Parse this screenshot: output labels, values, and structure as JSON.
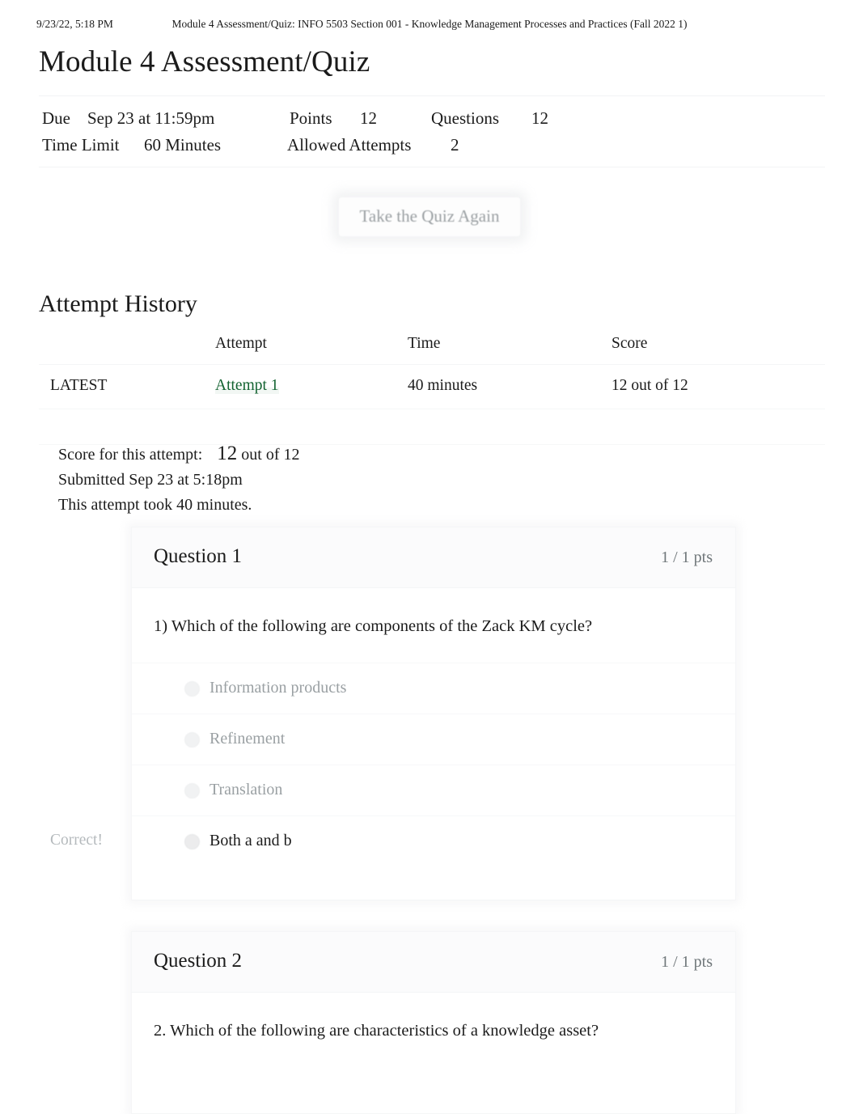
{
  "print_header": {
    "date": "9/23/22, 5:18 PM",
    "doc_title": "Module 4 Assessment/Quiz: INFO 5503 Section 001 - Knowledge Management Processes and Practices (Fall 2022 1)"
  },
  "page_title": "Module 4 Assessment/Quiz",
  "quiz_meta": {
    "due_label": "Due",
    "due_value": "Sep 23 at 11:59pm",
    "points_label": "Points",
    "points_value": "12",
    "questions_label": "Questions",
    "questions_value": "12",
    "time_limit_label": "Time Limit",
    "time_limit_value": "60 Minutes",
    "allowed_attempts_label": "Allowed Attempts",
    "allowed_attempts_value": "2"
  },
  "retake_button": {
    "label": "Take the Quiz Again"
  },
  "attempt_history": {
    "heading": "Attempt History",
    "columns": [
      "",
      "Attempt",
      "Time",
      "Score"
    ],
    "rows": [
      {
        "kept": "LATEST",
        "attempt": "Attempt 1",
        "time": "40 minutes",
        "score": "12 out of 12"
      }
    ]
  },
  "score_summary": {
    "score_label": "Score for this attempt:",
    "score_value": "12",
    "score_outof": "out of 12",
    "submitted": "Submitted Sep 23 at 5:18pm",
    "duration": "This attempt took 40 minutes."
  },
  "questions": [
    {
      "name": "Question 1",
      "points": "1 / 1 pts",
      "text": "1) Which of the following are components of the Zack KM cycle?",
      "correct_tag": "Correct!",
      "answers": [
        {
          "text": "Information products",
          "selected": false
        },
        {
          "text": "Refinement",
          "selected": false
        },
        {
          "text": "Translation",
          "selected": false
        },
        {
          "text": "Both a and b",
          "selected": true
        }
      ]
    },
    {
      "name": "Question 2",
      "points": "1 / 1 pts",
      "text": "2. Which of the following are characteristics of a knowledge asset?",
      "correct_tag": "",
      "answers": []
    }
  ],
  "colors": {
    "link_green": "#136331",
    "text": "#1b1b1b",
    "muted": "#9aa0a3"
  }
}
